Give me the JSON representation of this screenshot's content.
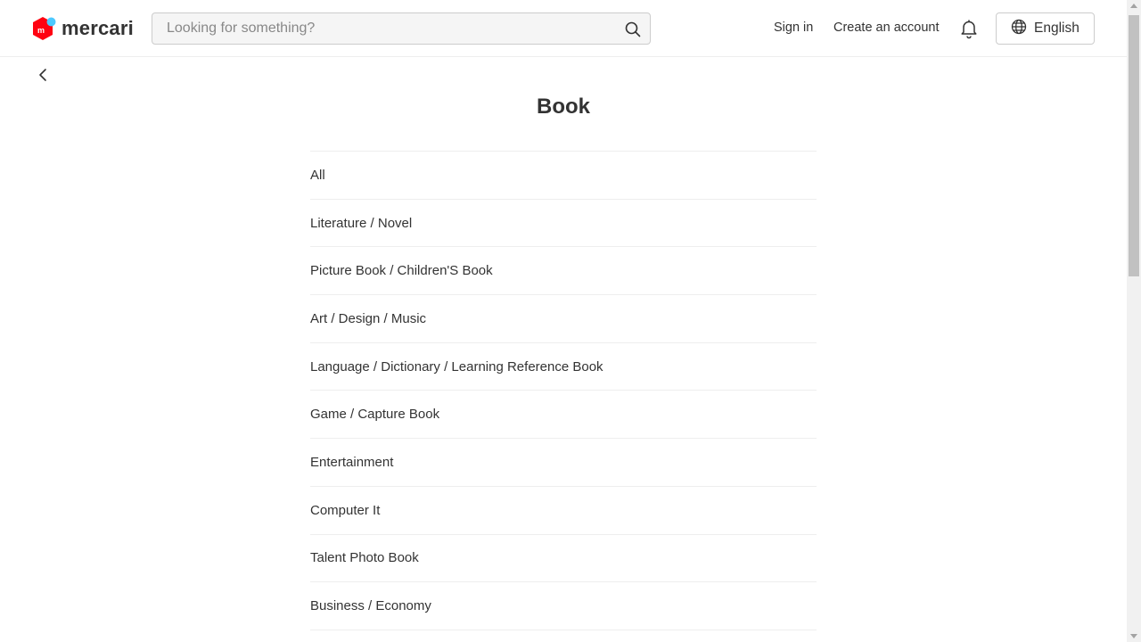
{
  "header": {
    "logo_text": "mercari",
    "search_placeholder": "Looking for something?",
    "sign_in": "Sign in",
    "create_account": "Create an account",
    "language": "English"
  },
  "icons": {
    "search": "search-icon",
    "bell": "bell-icon",
    "globe": "globe-icon",
    "back": "chevron-left-icon"
  },
  "colors": {
    "brand_red": "#ff0211",
    "brand_blue": "#4dc9ff",
    "text": "#333333",
    "divider": "#eeeeee"
  },
  "page": {
    "title": "Book",
    "categories": [
      {
        "label": "All"
      },
      {
        "label": "Literature / Novel"
      },
      {
        "label": "Picture Book / Children'S Book"
      },
      {
        "label": "Art / Design / Music"
      },
      {
        "label": "Language / Dictionary / Learning Reference Book"
      },
      {
        "label": "Game / Capture Book"
      },
      {
        "label": "Entertainment"
      },
      {
        "label": "Computer It"
      },
      {
        "label": "Talent Photo Book"
      },
      {
        "label": "Business / Economy"
      }
    ]
  }
}
